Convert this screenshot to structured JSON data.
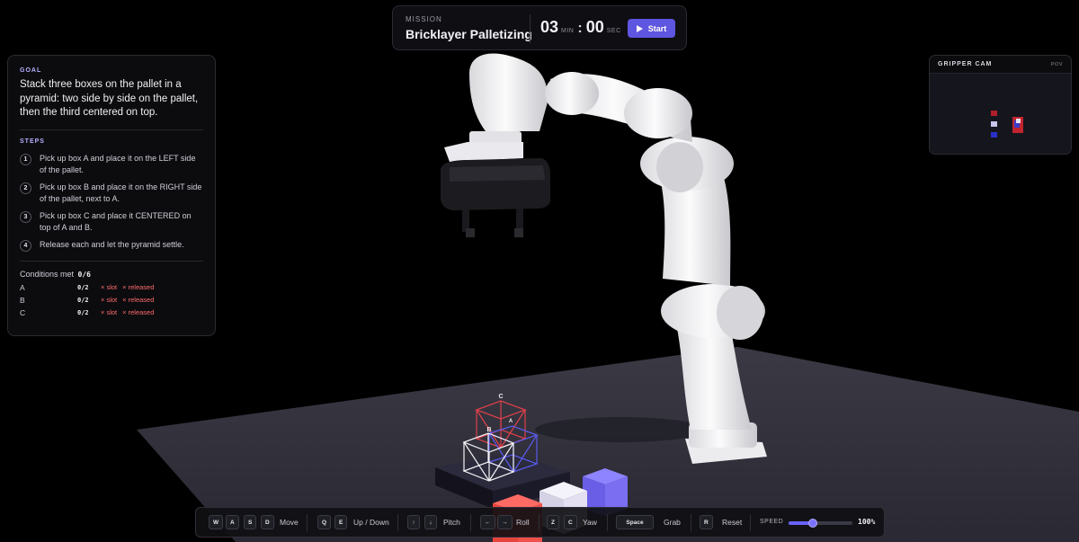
{
  "mission": {
    "label": "MISSION",
    "title": "Bricklayer Palletizing",
    "minutes": "03",
    "minutes_unit": "MIN",
    "separator": ":",
    "seconds": "00",
    "seconds_unit": "SEC",
    "start_label": "Start"
  },
  "goal": {
    "label": "GOAL",
    "text": "Stack three boxes on the pallet in a pyramid: two side by side on the pallet, then the third centered on top.",
    "steps_label": "STEPS",
    "steps": [
      {
        "num": "1",
        "text": "Pick up box A and place it on the LEFT side of the pallet."
      },
      {
        "num": "2",
        "text": "Pick up box B and place it on the RIGHT side of the pallet, next to A."
      },
      {
        "num": "3",
        "text": "Pick up box C and place it CENTERED on top of A and B."
      },
      {
        "num": "4",
        "text": "Release each and let the pyramid settle."
      }
    ],
    "conditions_label": "Conditions met",
    "conditions_count": "0/6",
    "conditions": [
      {
        "box": "A",
        "value": "0/2",
        "slot": "× slot",
        "released": "× released"
      },
      {
        "box": "B",
        "value": "0/2",
        "slot": "× slot",
        "released": "× released"
      },
      {
        "box": "C",
        "value": "0/2",
        "slot": "× slot",
        "released": "× released"
      }
    ]
  },
  "cam": {
    "title": "GRIPPER CAM",
    "tag": "POV"
  },
  "scene": {
    "labels": {
      "a": "A",
      "b": "B",
      "c": "C"
    },
    "colors": {
      "box_red": "#f0504a",
      "box_white": "#e4e0f2",
      "box_purple": "#7b6ef0",
      "target_red": "#e0404a",
      "target_white": "#f4f4f8",
      "target_blue": "#5a5cf0",
      "floor": "#2d2c36",
      "pallet": "#232231"
    }
  },
  "controls": {
    "keys": {
      "w": "W",
      "a": "A",
      "s": "S",
      "d": "D",
      "q": "Q",
      "e": "E",
      "up": "↑",
      "down": "↓",
      "left": "←",
      "right": "→",
      "z": "Z",
      "c": "C",
      "space": "Space",
      "r": "R"
    },
    "labels": {
      "move": "Move",
      "updown": "Up / Down",
      "pitch": "Pitch",
      "roll": "Roll",
      "yaw": "Yaw",
      "grab": "Grab",
      "reset": "Reset"
    },
    "speed_label": "SPEED",
    "speed_value": "100%",
    "speed_fraction": 0.38,
    "accent": "#6a62ff"
  }
}
